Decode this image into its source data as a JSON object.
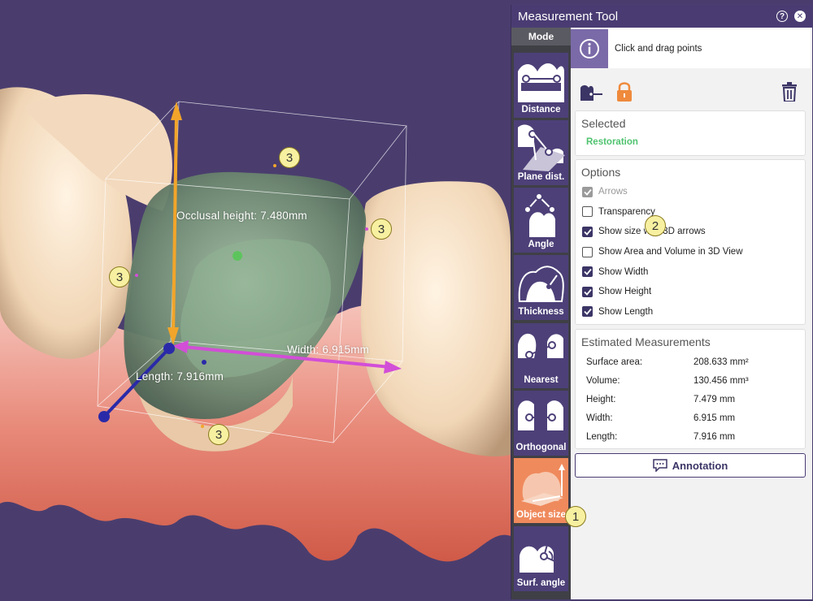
{
  "viewport": {
    "labels": {
      "occlusal_height": "Occlusal height: 7.480mm",
      "width": "Width: 6.915mm",
      "length": "Length: 7.916mm"
    },
    "callouts": {
      "top": "3",
      "right": "3",
      "left": "3",
      "bottom": "3"
    }
  },
  "panel": {
    "title": "Measurement Tool",
    "help_icon": "question-icon",
    "close_icon": "close-icon",
    "mode_label": "Mode",
    "modes": [
      {
        "label": "Distance",
        "icon": "distance-icon",
        "active": false
      },
      {
        "label": "Plane dist.",
        "icon": "plane-distance-icon",
        "active": false
      },
      {
        "label": "Angle",
        "icon": "angle-icon",
        "active": false
      },
      {
        "label": "Thickness",
        "icon": "thickness-icon",
        "active": false
      },
      {
        "label": "Nearest",
        "icon": "nearest-icon",
        "active": false
      },
      {
        "label": "Orthogonal",
        "icon": "orthogonal-icon",
        "active": false
      },
      {
        "label": "Object size",
        "icon": "object-size-icon",
        "active": true
      },
      {
        "label": "Surf. angle",
        "icon": "surface-angle-icon",
        "active": false
      }
    ],
    "mode_callout": "1",
    "info_text": "Click and drag points",
    "selected": {
      "title": "Selected",
      "value": "Restoration"
    },
    "options": {
      "title": "Options",
      "items": [
        {
          "label": "Arrows",
          "checked": true,
          "disabled": true
        },
        {
          "label": "Transparency",
          "checked": false,
          "disabled": false
        },
        {
          "label": "Show size with 3D arrows",
          "checked": true,
          "disabled": false
        },
        {
          "label": "Show Area and Volume in 3D View",
          "checked": false,
          "disabled": false
        },
        {
          "label": "Show Width",
          "checked": true,
          "disabled": false
        },
        {
          "label": "Show Height",
          "checked": true,
          "disabled": false
        },
        {
          "label": "Show Length",
          "checked": true,
          "disabled": false
        }
      ],
      "callout": "2"
    },
    "measurements": {
      "title": "Estimated Measurements",
      "rows": [
        {
          "name": "Surface area:",
          "value": "208.633  mm²"
        },
        {
          "name": "Volume:",
          "value": "130.456  mm³"
        },
        {
          "name": "Height:",
          "value": "7.479 mm"
        },
        {
          "name": "Width:",
          "value": "6.915 mm"
        },
        {
          "name": "Length:",
          "value": "7.916 mm"
        }
      ]
    },
    "annotation_label": "Annotation",
    "colors": {
      "header": "#4a3c73",
      "mode_button": "#4d4078",
      "mode_active": "#ef8a5d",
      "accent_green": "#4fc36f",
      "lock_orange": "#ef8a3c"
    }
  }
}
